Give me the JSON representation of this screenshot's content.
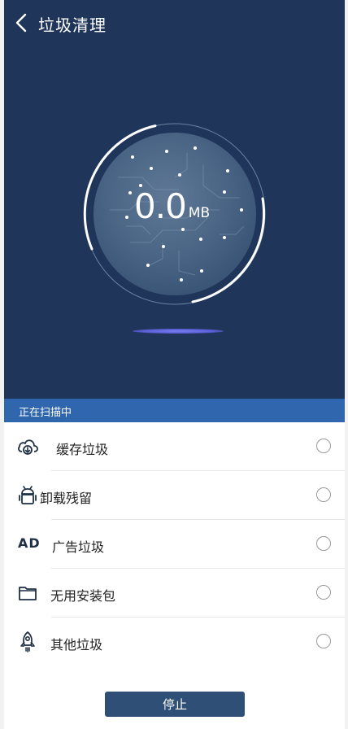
{
  "header": {
    "title": "垃圾清理"
  },
  "scan": {
    "size_value": "0.0",
    "size_unit": "MB",
    "status": "正在扫描中"
  },
  "categories": [
    {
      "label": "缓存垃圾",
      "icon": "cloud-download-icon"
    },
    {
      "label": "卸载残留",
      "icon": "android-icon"
    },
    {
      "label": "广告垃圾",
      "icon": "ad-icon",
      "icon_text": "AD"
    },
    {
      "label": "无用安装包",
      "icon": "folder-icon"
    },
    {
      "label": "其他垃圾",
      "icon": "rocket-icon"
    }
  ],
  "footer": {
    "stop_label": "停止"
  },
  "colors": {
    "hero_bg": "#1f3559",
    "scan_bar": "#2f66ad",
    "button": "#2f4f76"
  }
}
